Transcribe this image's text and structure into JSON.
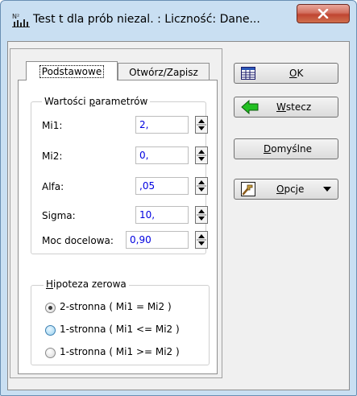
{
  "window": {
    "title": "Test t dla prób niezal. : Liczność: Dane...",
    "app_icon": "chart-app-icon",
    "close_icon": "close-x-icon"
  },
  "tabs": [
    {
      "label": "Podstawowe",
      "selected": true
    },
    {
      "label": "Otwórz/Zapisz",
      "selected": false
    }
  ],
  "params_group": {
    "legend": "Wartości parametrów",
    "fields": [
      {
        "label": "Mi1:",
        "value": "2,"
      },
      {
        "label": "Mi2:",
        "value": "0,"
      },
      {
        "label": "Alfa:",
        "value": ",05"
      },
      {
        "label": "Sigma:",
        "value": "10,"
      },
      {
        "label": "Moc docelowa:",
        "value": "0,90"
      }
    ]
  },
  "hypothesis_group": {
    "legend": "Hipoteza zerowa",
    "options": [
      {
        "label": "2-stronna ( Mi1 = Mi2 )",
        "selected": true
      },
      {
        "label": "1-stronna ( Mi1 <= Mi2 )",
        "selected": false
      },
      {
        "label": "1-stronna ( Mi1 >= Mi2 )",
        "selected": false
      }
    ]
  },
  "buttons": {
    "ok": "OK",
    "back": "Wstecz",
    "defaults": "Domyślne",
    "options": "Opcje"
  },
  "colors": {
    "frame": "#c9dff2",
    "field_text": "#0000e0",
    "close": "#c04532",
    "back_arrow": "#22c022"
  }
}
